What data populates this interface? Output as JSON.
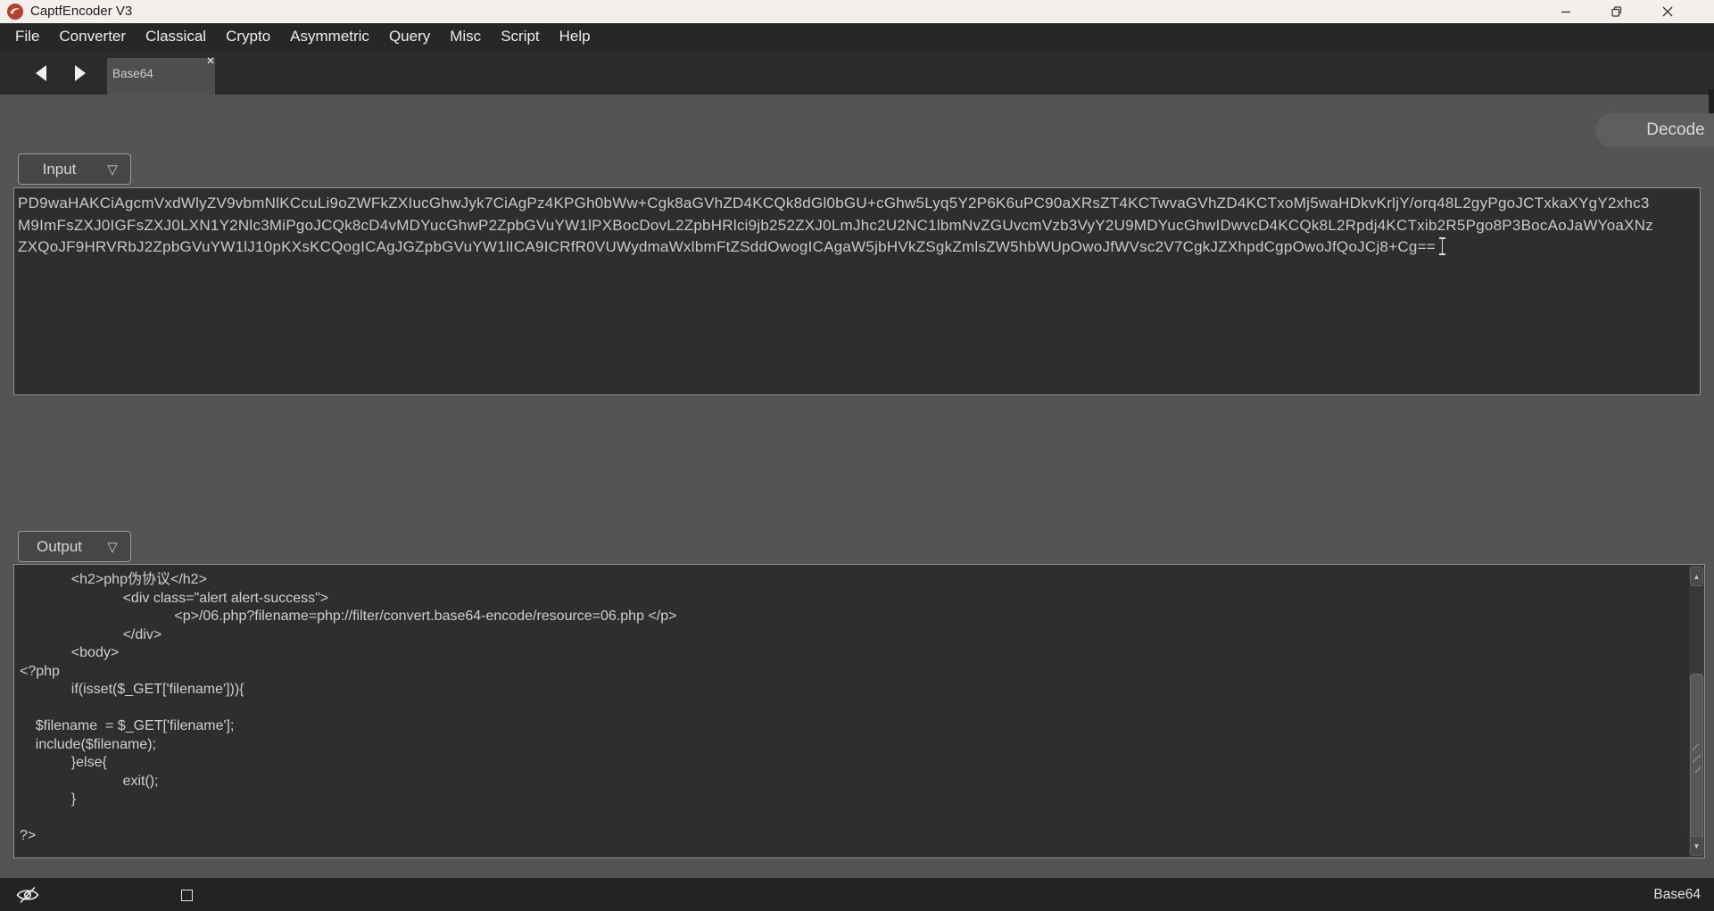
{
  "window": {
    "title": "CaptfEncoder V3",
    "controls": {
      "minimize": "minimize",
      "maximize": "maximize",
      "close": "close"
    }
  },
  "menu": {
    "items": [
      "File",
      "Converter",
      "Classical",
      "Crypto",
      "Asymmetric",
      "Query",
      "Misc",
      "Script",
      "Help"
    ]
  },
  "tabs": {
    "active_label": "Base64",
    "close_glyph": "×"
  },
  "toolbar": {
    "decode_label": "Decode"
  },
  "input_section": {
    "selector_label": "Input",
    "dropdown_glyph": "▽",
    "lines": [
      "PD9waHAKCiAgcmVxdWlyZV9vbmNlKCcuLi9oZWFkZXIucGhwJyk7CiAgPz4KPGh0bWw+Cgk8aGVhZD4KCQk8dGl0bGU+cGhw5Lyq5Y2P6K6uPC90aXRsZT4KCTwvaGVhZD4KCTxoMj5waHDkvKrljY/orq48L2gyPgoJCTxkaXYgY2xhc3",
      "M9ImFsZXJ0IGFsZXJ0LXN1Y2Nlc3MiPgoJCQk8cD4vMDYucGhwP2ZpbGVuYW1lPXBocDovL2ZpbHRlci9jb252ZXJ0LmJhc2U2NC1lbmNvZGUvcmVzb3VyY2U9MDYucGhwIDwvcD4KCQk8L2Rpdj4KCTxib2R5Pgo8P3BocAoJaWYoaXNz",
      "ZXQoJF9HRVRbJ2ZpbGVuYW1lJ10pKXsKCQogICAgJGZpbGVuYW1lICA9ICRfR0VUWydmaWxlbmFtZSddOwogICAgaW5jbHVkZSgkZmlsZW5hbWUpOwoJfWVsc2V7CgkJZXhpdCgpOwoJfQoJCj8+Cg=="
    ]
  },
  "output_section": {
    "selector_label": "Output",
    "dropdown_glyph": "▽",
    "lines": [
      "\t<h2>php伪协议</h2>",
      "\t\t<div class=\"alert alert-success\">",
      "\t\t\t<p>/06.php?filename=php://filter/convert.base64-encode/resource=06.php </p>",
      "\t\t</div>",
      "\t<body>",
      "<?php",
      "\tif(isset($_GET['filename'])){",
      "\t",
      "    $filename  = $_GET['filename'];",
      "    include($filename);",
      "\t}else{",
      "\t\texit();",
      "\t}",
      "\t",
      "?>"
    ]
  },
  "status_bar": {
    "right_label": "Base64"
  },
  "colors": {
    "titlebar_bg": "#f4eeec",
    "menubar_bg": "#272727",
    "content_bg": "#545454",
    "box_bg": "#2e2e2e",
    "logo_red": "#b2402c",
    "text_light": "#cfcfcf"
  }
}
